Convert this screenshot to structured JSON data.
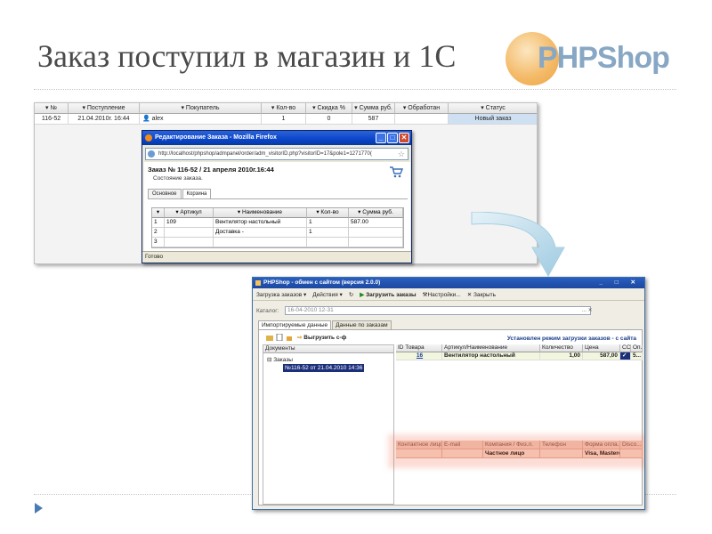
{
  "slide": {
    "title": "Заказ поступил в магазин и 1С",
    "logo_text": "PHPShop"
  },
  "orders": {
    "headers": [
      "▾ №",
      "▾ Поступление",
      "▾ Покупатель",
      "▾ Кол-во",
      "▾ Скидка %",
      "▾ Сумма руб.",
      "▾ Обработан",
      "▾ Статус"
    ],
    "row": {
      "num": "116-52",
      "date": "21.04.2010г. 16:44",
      "buyer": "alex",
      "qty": "1",
      "discount": "0",
      "sum": "587",
      "processed": "",
      "status": "Новый заказ"
    }
  },
  "popup": {
    "title": "Редактирование Заказа - Mozilla Firefox",
    "url": "http://localhost/phpshop/admpanel/order/adm_visitorID.php?visitorID=17&pole1=1271770(",
    "order_title": "Заказ № 116-52 / 21 апреля 2010г.16:44",
    "order_subtitle": "Состояние заказа.",
    "tabs": [
      "Основное",
      "Корзина"
    ],
    "grid": {
      "headers": [
        "▾",
        "▾ Артикул",
        "▾ Наименование",
        "▾ Кол-во",
        "▾ Сумма руб."
      ],
      "rows": [
        [
          "1",
          "109",
          "Вентилятор настольный",
          "1",
          "587.00"
        ],
        [
          "2",
          "",
          "Доставка -",
          "1",
          ""
        ],
        [
          "3",
          "",
          "",
          "",
          ""
        ]
      ]
    },
    "status": "Готово"
  },
  "exchange": {
    "title": "PHPShop - обмен с сайтом (версия 2.0.0)",
    "title_buttons": "_ □ ✕",
    "toolbar": {
      "load_orders": "Загрузка заказов ▾",
      "actions": "Действия ▾",
      "load": "Загрузить заказы",
      "settings": "Настройки...",
      "close": "Закрыть"
    },
    "catalog_label": "Каталог:",
    "catalog_value": "16-04-2010 12-31",
    "catalog_btn": "... ✕",
    "tabs": [
      "Импортируемые данные",
      "Данные по заказам"
    ],
    "upload_label": "Выгрузить с-ф",
    "mode_text": "Установлен режим загрузки заказов - с сайта",
    "tree": {
      "header": "Документы",
      "root": "⊟ Заказы",
      "child": "№116-52 от 21.04.2010 14:36"
    },
    "items": {
      "headers": [
        "ID Товара",
        "Артикул/Наименование",
        "Количество",
        "Цена",
        "СС",
        "Оп."
      ],
      "row": [
        "16",
        "Вентилятор настольный",
        "1,00",
        "587,00",
        "✓",
        "5..."
      ]
    },
    "contacts": {
      "headers": [
        "Контактное лицо",
        "E-mail",
        "Компания / Физ.л.",
        "Телефон",
        "Форма опла...",
        "Disco..."
      ],
      "row": [
        "",
        "",
        "Частное лицо",
        "",
        "Visa, Mastercar",
        ""
      ]
    }
  }
}
